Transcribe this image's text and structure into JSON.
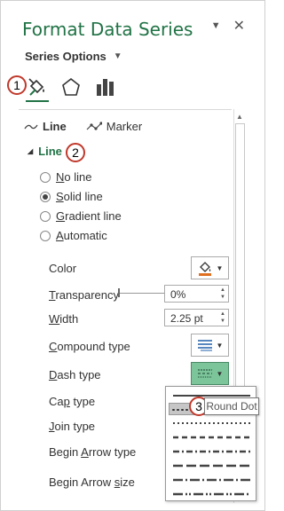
{
  "pane": {
    "title": "Format Data Series",
    "dropdown_caret": "▼",
    "close": "✕",
    "series_options_label": "Series Options",
    "series_options_caret": "▼"
  },
  "tabs": {
    "icons": [
      "fill-line-icon",
      "effects-pentagon-icon",
      "series-options-bars-icon"
    ],
    "active": "fill-line-icon"
  },
  "badges": [
    "1",
    "2",
    "3"
  ],
  "sub_tabs": [
    {
      "label": "Line",
      "icon": "line-icon",
      "active": true
    },
    {
      "label": "Marker",
      "icon": "marker-icon",
      "active": false
    }
  ],
  "section": {
    "label": "Line",
    "expanded_glyph": "◢"
  },
  "radios": [
    {
      "label": "No line",
      "checked": false
    },
    {
      "label": "Solid line",
      "checked": true
    },
    {
      "label": "Gradient line",
      "checked": false
    },
    {
      "label": "Automatic",
      "checked": false
    }
  ],
  "props": {
    "color": "Color",
    "transparency": "Transparency",
    "width": "Width",
    "compound_type": "Compound type",
    "dash_type": "Dash type",
    "cap_type": "Cap type",
    "join_type": "Join type",
    "begin_arrow_type": "Begin Arrow type",
    "begin_arrow_size": "Begin Arrow size"
  },
  "values": {
    "transparency": "0%",
    "width": "2.25 pt"
  },
  "tooltip": "Round Dot",
  "colors": {
    "accent": "#217346",
    "badge_border": "#c0392b",
    "line_color": "#e07020",
    "active_button": "#7cc49a"
  },
  "spin_up": "▲",
  "spin_down": "▼"
}
